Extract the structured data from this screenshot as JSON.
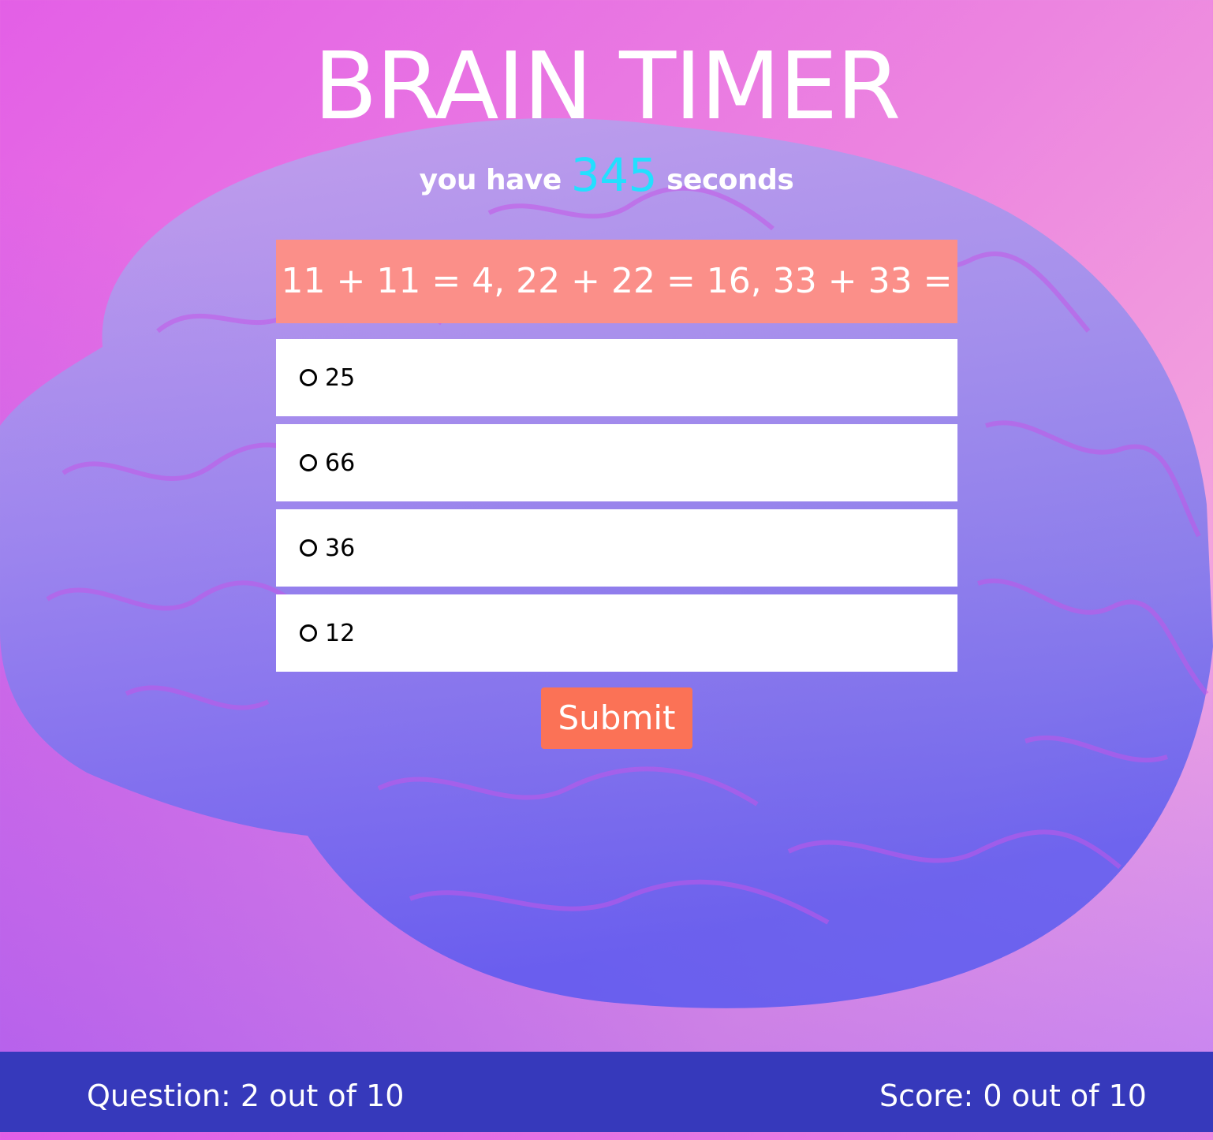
{
  "app": {
    "title": "BRAIN TIMER"
  },
  "timer": {
    "prefix": "you have",
    "seconds_left": "345",
    "suffix": "seconds"
  },
  "quiz": {
    "question": "11 + 11 = 4, 22 + 22 = 16, 33 + 33 = ?",
    "options": [
      {
        "label": "25"
      },
      {
        "label": "66"
      },
      {
        "label": "36"
      },
      {
        "label": "12"
      }
    ],
    "submit_label": "Submit"
  },
  "footer": {
    "question_progress": "Question: 2 out of 10",
    "score": "Score: 0 out of 10"
  },
  "colors": {
    "question_bg": "#fb8f89",
    "submit_bg": "#fb7256",
    "footer_bg": "#3639bb",
    "timer_accent": "#22e0ff"
  }
}
